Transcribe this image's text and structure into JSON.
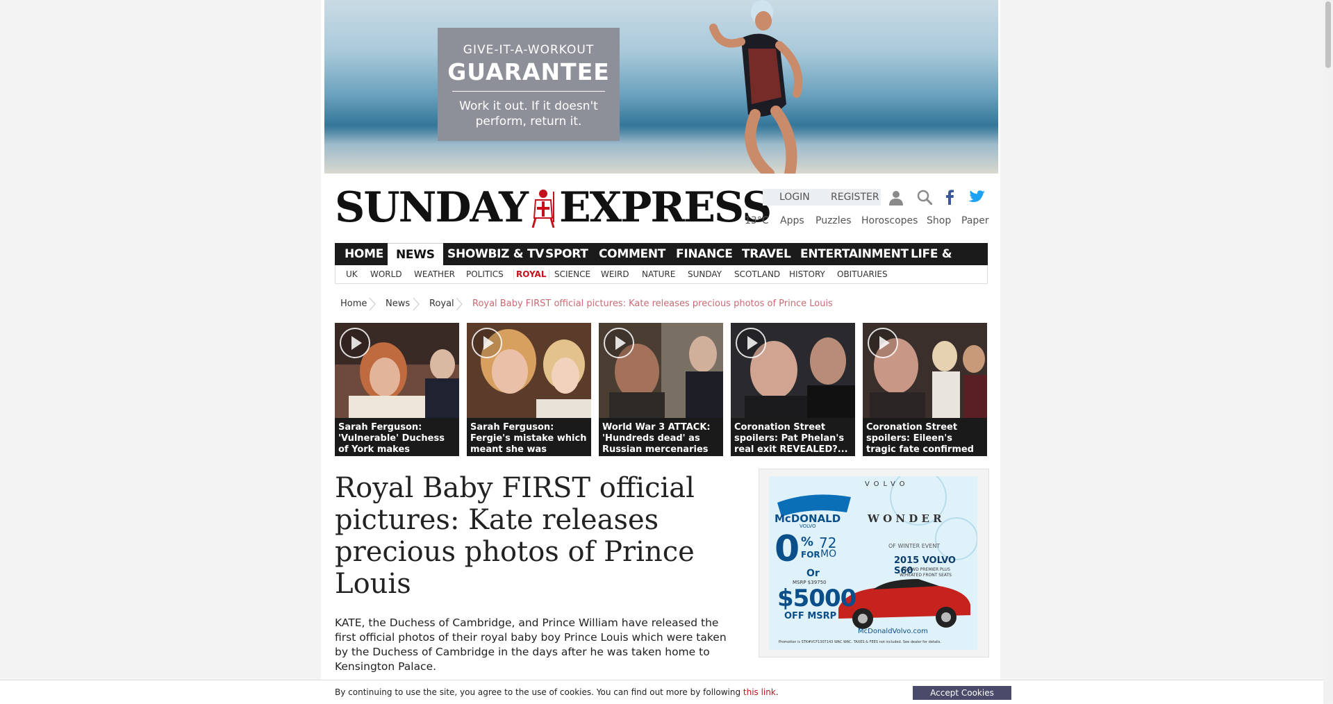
{
  "ad_top": {
    "line1": "GIVE-IT-A-WORKOUT",
    "line2": "GUARANTEE",
    "line3": "Work it out. If it doesn't",
    "line4": "perform, return it."
  },
  "logo": {
    "left": "SUNDAY",
    "right": "EXPRESS"
  },
  "account": {
    "login": "LOGIN",
    "register": "REGISTER"
  },
  "utility": {
    "temp": "13°C",
    "apps": "Apps",
    "puzzles": "Puzzles",
    "horoscopes": "Horoscopes",
    "shop": "Shop",
    "paper": "Paper"
  },
  "nav": {
    "items": [
      "HOME",
      "NEWS",
      "SHOWBIZ & TV",
      "SPORT",
      "COMMENT",
      "FINANCE",
      "TRAVEL",
      "ENTERTAINMENT",
      "LIFE & STYLE"
    ],
    "active": "NEWS"
  },
  "subnav": {
    "items": [
      "UK",
      "WORLD",
      "WEATHER",
      "POLITICS",
      "ROYAL",
      "SCIENCE",
      "WEIRD",
      "NATURE",
      "SUNDAY",
      "SCOTLAND",
      "HISTORY",
      "OBITUARIES"
    ],
    "active": "ROYAL"
  },
  "breadcrumb": {
    "items": [
      "Home",
      "News",
      "Royal"
    ],
    "current": "Royal Baby FIRST official pictures: Kate releases precious photos of Prince Louis"
  },
  "videos": [
    {
      "caption": "Sarah Ferguson: 'Vulnerable' Duchess of York makes"
    },
    {
      "caption": "Sarah Ferguson: Fergie's mistake which meant she was"
    },
    {
      "caption": "World War 3 ATTACK: 'Hundreds dead' as Russian mercenaries"
    },
    {
      "caption": "Coronation Street spoilers: Pat Phelan's real exit REVEALED?..."
    },
    {
      "caption": "Coronation Street spoilers: Eileen's tragic fate confirmed"
    }
  ],
  "article": {
    "headline": "Royal Baby FIRST official pictures: Kate releases precious photos of Prince Louis",
    "intro": "KATE, the Duchess of Cambridge, and Prince William have released the first official photos of their royal baby boy Prince Louis which were taken by the Duchess of Cambridge in the days after he was taken home to Kensington Palace."
  },
  "ad_side": {
    "brand": "VOLVO",
    "dealer": "McDONALD",
    "dealer_sub": "VOLVO",
    "wonder": "W O N D E R",
    "event": "OF WINTER EVENT",
    "model": "2015 VOLVO S60",
    "model_sub": "T5 AWD PREMIER PLUS",
    "model_sub2": "W/HEATED FRONT SEATS",
    "rate": "0",
    "rate_pct": "%",
    "rate_for": "FOR",
    "months": "72",
    "months_unit": "MO",
    "or": "Or",
    "msrp": "MSRP $39750",
    "discount": "$5000",
    "discount_sub": "OFF MSRP",
    "url": "McDonaldVolvo.com",
    "fineprint": "Promotion is STK#VCF1307143 WAC WAC. TAXES & FEES not included. See dealer for details."
  },
  "cookie": {
    "message": "By continuing to use the site, you agree to the use of cookies. You can find out more by following ",
    "link": "this link",
    "after": ".",
    "button": "Accept Cookies"
  },
  "colors": {
    "brand_red": "#c3121b",
    "nav_bg": "#1b1b1b",
    "cookie_btn": "#4a4a6a"
  }
}
